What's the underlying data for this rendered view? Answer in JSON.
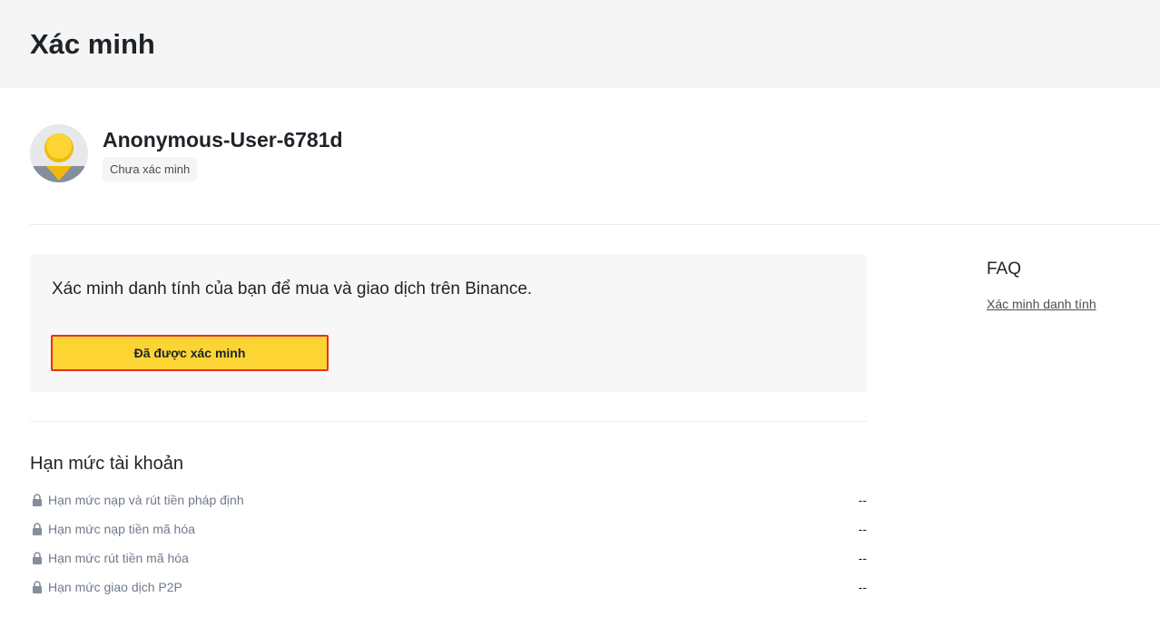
{
  "header": {
    "title": "Xác minh"
  },
  "profile": {
    "username": "Anonymous-User-6781d",
    "status": "Chưa xác minh",
    "avatar_icon": "user-avatar-icon"
  },
  "verification": {
    "text": "Xác minh danh tính của bạn để mua và giao dịch trên Binance.",
    "button_label": "Đã được xác minh"
  },
  "limits": {
    "title": "Hạn mức tài khoản",
    "items": [
      {
        "label": "Hạn mức nạp và rút tiền pháp định",
        "value": "--"
      },
      {
        "label": "Hạn mức nạp tiền mã hóa",
        "value": "--"
      },
      {
        "label": "Hạn mức rút tiền mã hóa",
        "value": "--"
      },
      {
        "label": "Hạn mức giao dịch P2P",
        "value": "--"
      }
    ]
  },
  "faq": {
    "title": "FAQ",
    "links": [
      "Xác minh danh tính"
    ]
  },
  "colors": {
    "accent": "#fcd535",
    "highlight_border": "#e8301f",
    "header_bg": "#f5f5f5"
  }
}
